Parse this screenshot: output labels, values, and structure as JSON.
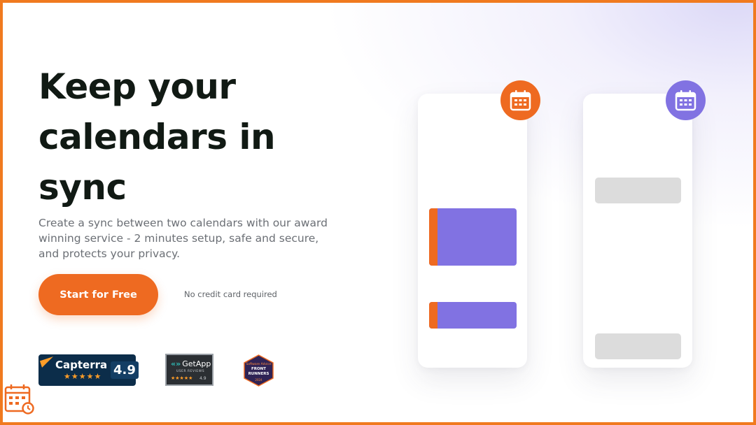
{
  "hero": {
    "title": "Keep your calendars in sync",
    "subtitle": "Create a sync between two calendars with our award winning service - 2 minutes setup, safe and secure, and protects your privacy.",
    "cta_label": "Start for Free",
    "note": "No credit card required"
  },
  "badges": {
    "capterra": {
      "name": "Capterra",
      "rating": "4.9",
      "stars": "★★★★★"
    },
    "getapp": {
      "name": "GetApp",
      "caption": "USER REVIEWS",
      "rating": "4.9",
      "stars": "★★★★★"
    },
    "software_advice": {
      "line1": "Software Advice",
      "line2": "FRONT RUNNERS",
      "year": "2024"
    }
  },
  "illustration": {
    "left_calendar_icon": "calendar-icon",
    "right_calendar_icon": "calendar-icon",
    "colors": {
      "orange": "#ee6a21",
      "purple": "#8172e2",
      "placeholder": "#dcdcdc"
    }
  },
  "theme": {
    "accent": "#ee6a21",
    "border": "#f07a1f",
    "heading": "#111a14",
    "body_text": "#6b6f75"
  }
}
